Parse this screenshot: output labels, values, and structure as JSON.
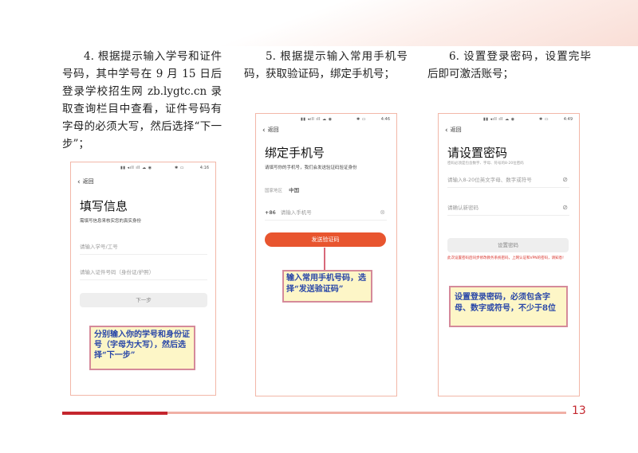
{
  "instructions": {
    "step4": "4. 根据提示输入学号和证件号码，其中学号在 9 月 15 日后登录学校招生网 zb.lygtc.cn 录取查询栏目中查看，证件号码有字母的必须大写，然后选择“下一步”；",
    "step5": "5. 根据提示输入常用手机号码，获取验证码，绑定手机号；",
    "step6": "6. 设置登录密码，设置完毕后即可激活账号；"
  },
  "phone1": {
    "signal": "▮▮ ◂ıll ıll ☁ ◉",
    "status_icons": "✱ ▭",
    "time": "4:16",
    "back": "返回",
    "title": "填写信息",
    "subtitle": "需填写信息来核实您的真实身份",
    "student_id_placeholder": "请输入学号/工号",
    "id_number_placeholder": "请输入证件号码（身份证/护照）",
    "next_button": "下一步",
    "callout": "分别输入你的学号和身份证号（字母为大写），然后选择“下一步”"
  },
  "phone2": {
    "signal": "▮▮ ◂ıll ıll ☁ ◉",
    "status_icons": "✱ ▭",
    "time": "4:46",
    "back": "返回",
    "title": "绑定手机号",
    "subtitle": "请填写你的手机号，我们会发送验证码验证身份",
    "region_label": "国家地区",
    "region_value": "中国",
    "country_code": "+86",
    "phone_placeholder": "请输入手机号",
    "send_button": "发送验证码",
    "callout": "输入常用手机号码，选择“发送验证码”"
  },
  "phone3": {
    "signal": "▮▮ ◂ıll ıll ☁ ◉",
    "status_icons": "✱ ▭",
    "time": "4:49",
    "back": "返回",
    "title": "请设置密码",
    "subtitle": "密码必须是包含数字、字母、符号的8-20位密码",
    "password_placeholder": "请输入8-20位英文字母、数字或符号",
    "confirm_placeholder": "请确认新密码",
    "set_button": "设置密码",
    "warning": "此次设置密码后同步修改教务系统密码，上网认证和VPN的密码，请知悉!",
    "callout": "设置登录密码，必须包含字母、数字或符号，不少于8位"
  },
  "footer": {
    "page_number": "13"
  },
  "colors": {
    "accent_red": "#e8552f",
    "footer_red": "#c4262e",
    "callout_bg": "#fdf6c7",
    "callout_text": "#2846a8"
  }
}
